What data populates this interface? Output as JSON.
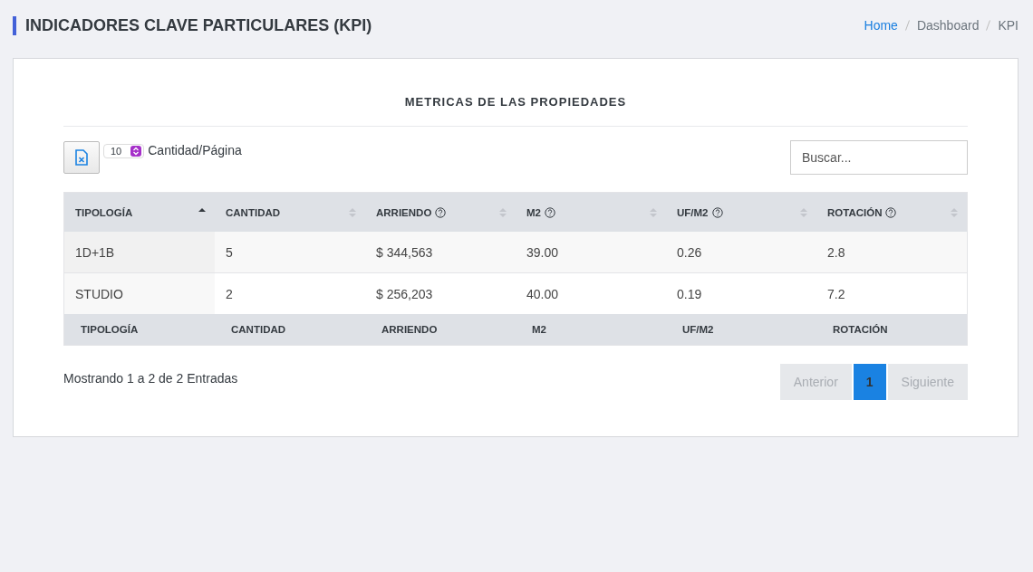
{
  "page_title": "INDICADORES CLAVE PARTICULARES (KPI)",
  "breadcrumb": [
    {
      "label": "Home",
      "link": true
    },
    {
      "label": "Dashboard",
      "link": false
    },
    {
      "label": "KPI",
      "link": false
    }
  ],
  "card": {
    "title": "METRICAS DE LAS PROPIEDADES",
    "page_size": {
      "value": "10",
      "label": "Cantidad/Página"
    },
    "search": {
      "placeholder": "Buscar..."
    },
    "table": {
      "columns": [
        {
          "label": "TIPOLOGÍA",
          "help": false,
          "sorted": true
        },
        {
          "label": "CANTIDAD",
          "help": false,
          "sorted": false
        },
        {
          "label": "ARRIENDO",
          "help": true,
          "sorted": false
        },
        {
          "label": "M2",
          "help": true,
          "sorted": false
        },
        {
          "label": "UF/M2",
          "help": true,
          "sorted": false
        },
        {
          "label": "ROTACIÓN",
          "help": true,
          "sorted": false
        }
      ],
      "rows": [
        [
          "1D+1B",
          "5",
          "$ 344,563",
          "39.00",
          "0.26",
          "2.8"
        ],
        [
          "STUDIO",
          "2",
          "$ 256,203",
          "40.00",
          "0.19",
          "7.2"
        ]
      ],
      "footer": [
        "TIPOLOGÍA",
        "CANTIDAD",
        "ARRIENDO",
        "M2",
        "UF/M2",
        "ROTACIÓN"
      ]
    },
    "info": "Mostrando 1 a 2 de 2 Entradas",
    "pagination": [
      {
        "label": "Anterior",
        "disabled": true,
        "selected": false
      },
      {
        "label": "1",
        "disabled": false,
        "selected": true
      },
      {
        "label": "Siguiente",
        "disabled": true,
        "selected": false
      }
    ]
  }
}
